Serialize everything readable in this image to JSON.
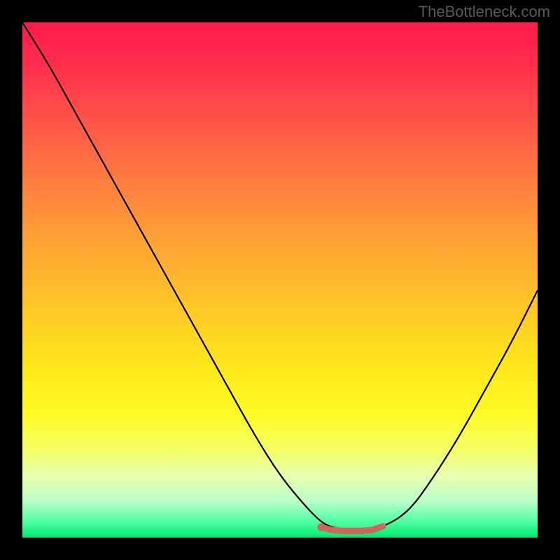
{
  "watermark": "TheBottleneck.com",
  "chart_data": {
    "type": "line",
    "title": "",
    "xlabel": "",
    "ylabel": "",
    "xlim": [
      0,
      100
    ],
    "ylim": [
      0,
      100
    ],
    "series": [
      {
        "name": "bottleneck-curve",
        "x": [
          0,
          5,
          10,
          15,
          20,
          25,
          30,
          35,
          40,
          45,
          50,
          55,
          58,
          60,
          63,
          66,
          70,
          75,
          80,
          85,
          90,
          95,
          100
        ],
        "y": [
          100,
          92,
          83,
          74,
          65,
          56,
          47,
          38,
          29,
          20,
          12,
          6,
          3,
          2,
          1.5,
          1.5,
          2,
          5,
          12,
          20,
          29,
          38,
          48
        ]
      },
      {
        "name": "optimal-band",
        "x": [
          58,
          60,
          62,
          64,
          66,
          68,
          70
        ],
        "y": [
          2.0,
          1.5,
          1.3,
          1.3,
          1.3,
          1.5,
          2.2
        ]
      }
    ],
    "colors": {
      "curve": "#000000",
      "optimal": "#d1645c",
      "gradient_top": "#ff1a4a",
      "gradient_bottom": "#00e86a"
    }
  }
}
